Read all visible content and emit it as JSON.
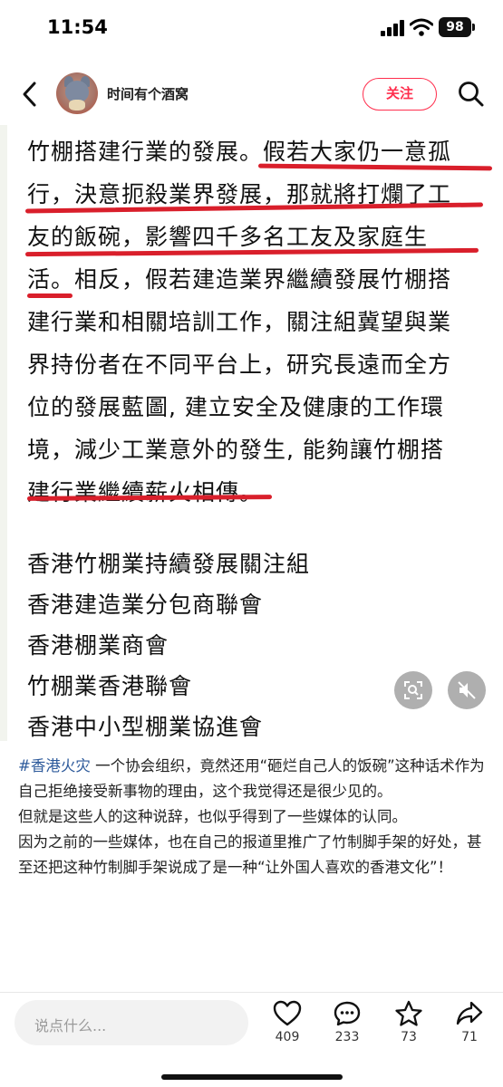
{
  "status_bar": {
    "time": "11:54",
    "battery": "98"
  },
  "header": {
    "username": "时间有个酒窝",
    "follow_label": "关注"
  },
  "image_text": {
    "lines": [
      "竹棚搭建行業的發展。假若大家仍一意孤",
      "行，決意扼殺業界發展，那就將打爛了工",
      "友的飯碗，影響四千多名工友及家庭生",
      "活。相反，假若建造業界繼續發展竹棚搭",
      "建行業和相關培訓工作，關注組冀望與業",
      "界持份者在不同平台上，研究長遠而全方",
      "位的發展藍圖, 建立安全及健康的工作環",
      "境，減少工業意外的發生, 能夠讓竹棚搭",
      "建行業繼續薪火相傳。",
      "香港竹棚業持續發展關注組",
      "香港建造業分包商聯會",
      "香港棚業商會",
      "竹棚業香港聯會",
      "香港中小型棚業協進會"
    ]
  },
  "caption": {
    "hashtag": "#香港火灾",
    "para1": " 一个协会组织，竟然还用“砸烂自己人的饭碗”这种话术作为自己拒绝接受新事物的理由，这个我觉得还是很少见的。",
    "para2": "但就是这些人的这种说辞，也似乎得到了一些媒体的认同。",
    "para3": "因为之前的一些媒体，也在自己的报道里推广了竹制脚手架的好处，甚至还把这种竹制脚手架说成了是一种“让外国人喜欢的香港文化”！"
  },
  "bottom_bar": {
    "comment_placeholder": "说点什么...",
    "likes": "409",
    "comments": "233",
    "stars": "73",
    "shares": "71"
  },
  "colors": {
    "accent": "#ff2e4d",
    "hashtag": "#2d5a9b",
    "highlight": "#d91f2b"
  }
}
